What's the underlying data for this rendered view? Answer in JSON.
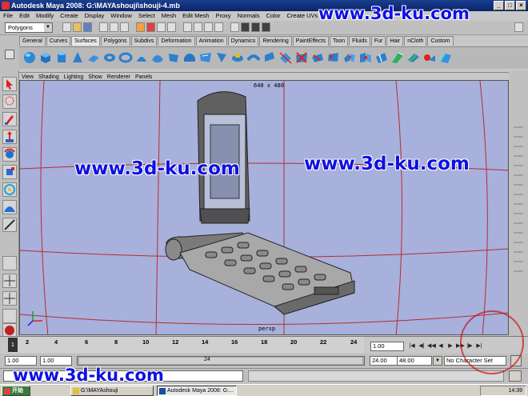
{
  "window": {
    "title": "Autodesk Maya 2008: G:\\MAYAshouji\\shouji-4.mb",
    "btn_min": "_",
    "btn_max": "□",
    "btn_close": "×"
  },
  "menubar": [
    "File",
    "Edit",
    "Modify",
    "Create",
    "Display",
    "Window",
    "Select",
    "Mesh",
    "Edit Mesh",
    "Proxy",
    "Normals",
    "Color",
    "Create UVs",
    "Ed"
  ],
  "toolbar": {
    "mode": "Polygons"
  },
  "shelf_tabs": [
    "General",
    "Curves",
    "Surfaces",
    "Polygons",
    "Subdivs",
    "Deformation",
    "Animation",
    "Dynamics",
    "Rendering",
    "PaintEffects",
    "Toon",
    "Fluids",
    "Fur",
    "Hair",
    "nCloth",
    "Custom"
  ],
  "active_shelf_tab": "Surfaces",
  "viewport": {
    "menu": [
      "View",
      "Shading",
      "Lighting",
      "Show",
      "Renderer",
      "Panels"
    ],
    "resolution": "640 x 480",
    "camera": "persp",
    "bg_color": "#a8b0dc",
    "grid_color": "#b03030"
  },
  "timeline": {
    "ticks": [
      "2",
      "4",
      "6",
      "8",
      "10",
      "12",
      "14",
      "16",
      "18",
      "20",
      "22",
      "24"
    ],
    "current_frame": "1",
    "current_time_field": "1.00"
  },
  "range": {
    "start": "1.00",
    "playback_start": "1.00",
    "slider_end": "24",
    "playback_end": "24.00",
    "end": "48.00",
    "character_set": "No Character Set"
  },
  "taskbar": {
    "start": "开始",
    "tasks": [
      "G:\\MAYAshouji",
      "Autodesk Maya 2008: G:..."
    ],
    "clock": "14:39"
  },
  "watermark": "www.3d-ku.com"
}
